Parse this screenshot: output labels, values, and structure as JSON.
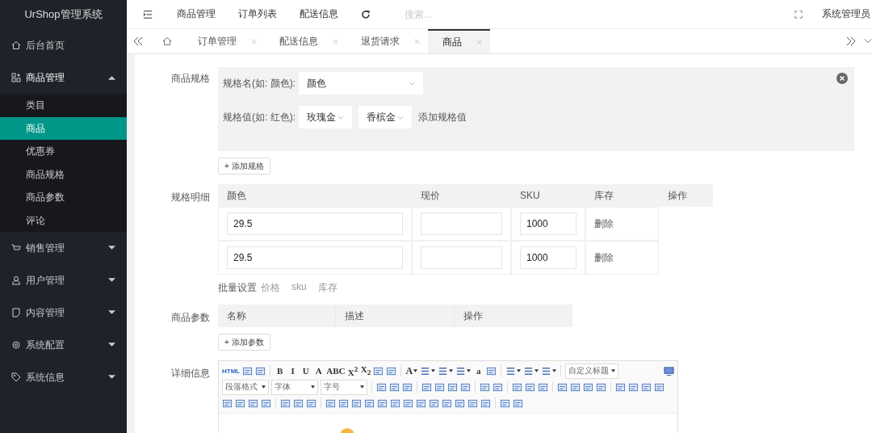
{
  "sidebar": {
    "title": "UrShop管理系统",
    "items": [
      {
        "label": "后台首页"
      },
      {
        "label": "商品管理",
        "expanded": true,
        "children": [
          {
            "label": "类目",
            "selected": false
          },
          {
            "label": "商品",
            "selected": true
          },
          {
            "label": "优惠券",
            "selected": false
          },
          {
            "label": "商品规格",
            "selected": false
          },
          {
            "label": "商品参数",
            "selected": false
          },
          {
            "label": "评论",
            "selected": false
          }
        ]
      },
      {
        "label": "销售管理",
        "expanded": false
      },
      {
        "label": "用户管理",
        "expanded": false
      },
      {
        "label": "内容管理",
        "expanded": false
      },
      {
        "label": "系统配置",
        "expanded": false
      },
      {
        "label": "系统信息",
        "expanded": false
      }
    ]
  },
  "top_nav": {
    "links": [
      "商品管理",
      "订单列表",
      "配送信息"
    ],
    "search": {
      "placeholder": "搜索..."
    },
    "user": "系统管理员"
  },
  "tabs": [
    {
      "label": "订单管理",
      "selected": false
    },
    {
      "label": "配送信息",
      "selected": false
    },
    {
      "label": "退货请求",
      "selected": false
    },
    {
      "label": "商品",
      "selected": true
    }
  ],
  "form": {
    "spec": {
      "label": "商品规格",
      "name_label": "规格名(如: 颜色):",
      "name_value": "颜色",
      "values_label": "规格值(如: 红色):",
      "values": [
        "玫瑰金",
        "香槟金"
      ],
      "add_value": "添加规格值",
      "add_button": "+ 添加规格"
    },
    "detail": {
      "label": "规格明细",
      "columns": [
        "颜色",
        "现价",
        "SKU",
        "库存",
        "操作"
      ],
      "rows": [
        {
          "spec_value": "29.5",
          "sku": "1000",
          "action": "删除"
        },
        {
          "spec_value": "29.5",
          "sku": "1000",
          "action": "删除"
        }
      ],
      "batch_label": "批量设置",
      "batch_links": [
        "价格",
        "sku",
        "库存"
      ]
    },
    "params": {
      "label": "商品参数",
      "columns": [
        "名称",
        "描述",
        "操作"
      ],
      "add_button": "+ 添加参数"
    },
    "editor": {
      "label": "详细信息",
      "toolbar": [
        [
          {
            "kind": "glyph",
            "label": "HTML"
          },
          {
            "kind": "icon"
          },
          {
            "kind": "icon"
          },
          {
            "kind": "sep"
          },
          {
            "kind": "glyph",
            "label": "B"
          },
          {
            "kind": "glyph",
            "label": "I"
          },
          {
            "kind": "glyph",
            "label": "U"
          },
          {
            "kind": "glyph",
            "label": "A"
          },
          {
            "kind": "glyph",
            "label": "ABC"
          },
          {
            "kind": "glyph",
            "label": "X$^{2}$"
          },
          {
            "kind": "glyph",
            "label": "X$_{2}$"
          },
          {
            "kind": "icon"
          },
          {
            "kind": "icon"
          },
          {
            "kind": "sep"
          },
          {
            "kind": "drop",
            "label": "A"
          },
          {
            "kind": "drop"
          },
          {
            "kind": "drop"
          },
          {
            "kind": "drop"
          },
          {
            "kind": "glyph",
            "label": "a"
          },
          {
            "kind": "icon"
          },
          {
            "kind": "sep"
          },
          {
            "kind": "drop"
          },
          {
            "kind": "drop"
          },
          {
            "kind": "drop"
          },
          {
            "kind": "sep"
          },
          {
            "kind": "select",
            "label": "自定义标题"
          }
        ],
        [
          {
            "kind": "select",
            "label": "段落格式"
          },
          {
            "kind": "select",
            "label": "字体"
          },
          {
            "kind": "select",
            "label": "字号"
          },
          {
            "kind": "sep"
          },
          {
            "kind": "icon"
          },
          {
            "kind": "icon"
          },
          {
            "kind": "icon"
          },
          {
            "kind": "sep"
          },
          {
            "kind": "icon"
          },
          {
            "kind": "icon"
          },
          {
            "kind": "icon"
          },
          {
            "kind": "icon"
          },
          {
            "kind": "sep"
          },
          {
            "kind": "icon"
          },
          {
            "kind": "icon"
          },
          {
            "kind": "sep"
          },
          {
            "kind": "icon"
          },
          {
            "kind": "icon"
          },
          {
            "kind": "icon"
          },
          {
            "kind": "sep"
          },
          {
            "kind": "icon"
          },
          {
            "kind": "icon"
          },
          {
            "kind": "icon"
          },
          {
            "kind": "icon"
          },
          {
            "kind": "sep"
          },
          {
            "kind": "icon"
          },
          {
            "kind": "icon"
          },
          {
            "kind": "icon"
          },
          {
            "kind": "icon"
          }
        ],
        [
          {
            "kind": "icon"
          },
          {
            "kind": "icon"
          },
          {
            "kind": "icon"
          },
          {
            "kind": "icon"
          },
          {
            "kind": "sep"
          },
          {
            "kind": "icon"
          },
          {
            "kind": "icon"
          },
          {
            "kind": "icon"
          },
          {
            "kind": "sep"
          },
          {
            "kind": "icon"
          },
          {
            "kind": "icon"
          },
          {
            "kind": "icon"
          },
          {
            "kind": "icon"
          },
          {
            "kind": "icon"
          },
          {
            "kind": "icon"
          },
          {
            "kind": "icon"
          },
          {
            "kind": "icon"
          },
          {
            "kind": "icon"
          },
          {
            "kind": "icon"
          },
          {
            "kind": "icon"
          },
          {
            "kind": "icon"
          },
          {
            "kind": "icon"
          },
          {
            "kind": "sep"
          },
          {
            "kind": "icon"
          },
          {
            "kind": "icon"
          }
        ]
      ]
    }
  }
}
